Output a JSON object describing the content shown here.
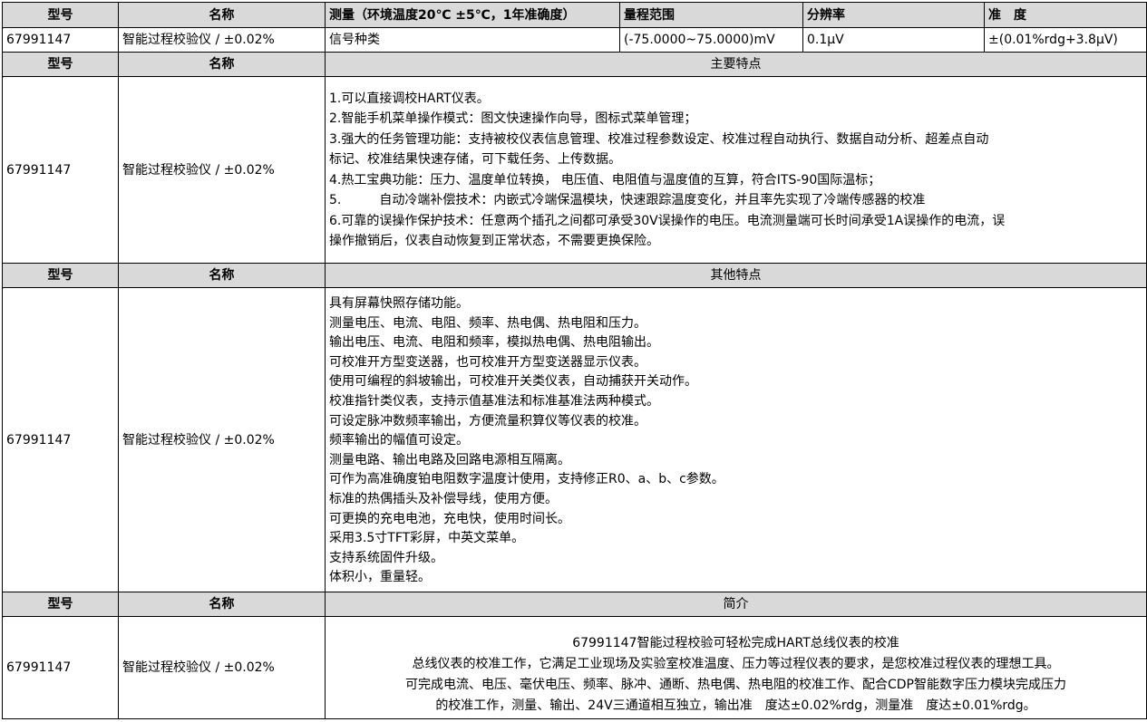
{
  "header": {
    "model_label": "型号",
    "name_label": "名称",
    "measure_label": "测量（环境温度20℃ ±5℃，1年准确度）",
    "range_label": "量程范围",
    "resolution_label": "分辨率",
    "accuracy_label": "准　度"
  },
  "spec_row": {
    "model": "67991147",
    "name": "智能过程校验仪 / ±0.02%",
    "signal": "信号种类",
    "range": "(-75.0000~75.0000)mV",
    "resolution": "0.1μV",
    "accuracy": "±(0.01%rdg+3.8μV)"
  },
  "main_features": {
    "model_label": "型号",
    "name_label": "名称",
    "title": "主要特点",
    "model": "67991147",
    "name": "智能过程校验仪 / ±0.02%",
    "lines": [
      "1.可以直接调校HART仪表。",
      "2.智能手机菜单操作模式：图文快速操作向导，图标式菜单管理；",
      "3.强大的任务管理功能：支持被校仪表信息管理、校准过程参数设定、校准过程自动执行、数据自动分析、超差点自动",
      "标记、校准结果快速存储，可下载任务、上传数据。",
      "4.热工宝典功能：压力、温度单位转换， 电压值、电阻值与温度值的互算，符合ITS-90国际温标；",
      "5.　　　自动冷端补偿技术：内嵌式冷端保温模块，快速跟踪温度变化，并且率先实现了冷端传感器的校准",
      "6.可靠的误操作保护技术：任意两个插孔之间都可承受30V误操作的电压。电流测量端可长时间承受1A误操作的电流，误",
      "操作撤销后，仪表自动恢复到正常状态，不需要更换保险。"
    ]
  },
  "other_features": {
    "model_label": "型号",
    "name_label": "名称",
    "title": "其他特点",
    "model": "67991147",
    "name": "智能过程校验仪 / ±0.02%",
    "lines": [
      "具有屏幕快照存储功能。",
      "测量电压、电流、电阻、频率、热电偶、热电阻和压力。",
      "输出电压、电流、电阻和频率，模拟热电偶、热电阻输出。",
      "可校准开方型变送器，也可校准开方型变送器显示仪表。",
      "使用可编程的斜坡输出，可校准开关类仪表，自动捕获开关动作。",
      "校准指针类仪表，支持示值基准法和标准基准法两种模式。",
      "可设定脉冲数频率输出，方便流量积算仪等仪表的校准。",
      "频率输出的幅值可设定。",
      "测量电路、输出电路及回路电源相互隔离。",
      "可作为高准确度铂电阻数字温度计使用，支持修正R0、a、b、c参数。",
      "标准的热偶插头及补偿导线，使用方便。",
      "可更换的充电电池，充电快，使用时间长。",
      "采用3.5寸TFT彩屏，中英文菜单。",
      "支持系统固件升级。",
      "体积小，重量轻。"
    ]
  },
  "intro": {
    "model_label": "型号",
    "name_label": "名称",
    "title": "简介",
    "model": "67991147",
    "name": "智能过程校验仪 / ±0.02%",
    "lines": [
      "67991147智能过程校验可轻松完成HART总线仪表的校准",
      "总线仪表的校准工作，它满足工业现场及实验室校准温度、压力等过程仪表的要求，是您校准过程仪表的理想工具。",
      "可完成电流、电压、毫伏电压、频率、脉冲、通断、热电偶、热电阻的校准工作、配合CDP智能数字压力模块完成压力",
      "的校准工作，测量、输出、24V三通道相互独立，输出准　度达±0.02%rdg，测量准　度达±0.01%rdg。"
    ]
  }
}
